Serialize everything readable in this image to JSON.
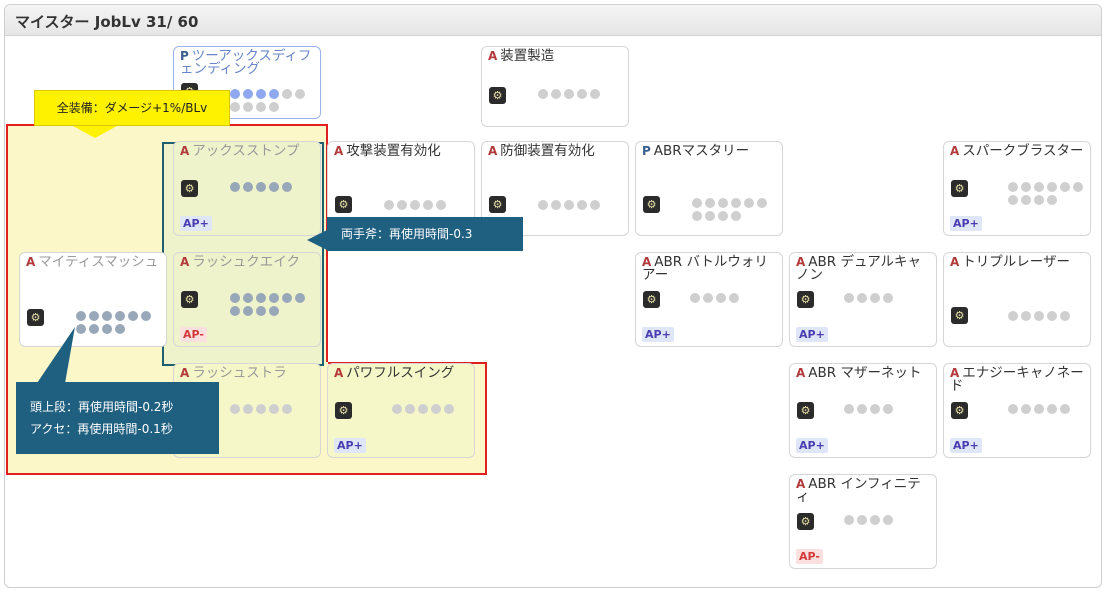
{
  "header": {
    "title": "マイスター JobLv 31/ 60"
  },
  "skills": [
    {
      "type": "P",
      "name": "ツーアックスディフェンディング",
      "dots": 5,
      "rows": 2,
      "filled": 4,
      "badge": ""
    },
    {
      "type": "A",
      "name": "装置製造",
      "dots": 5,
      "rows": 1,
      "filled": 0,
      "badge": ""
    },
    {
      "type": "A",
      "name": "アックスストンプ",
      "dots": 5,
      "rows": 1,
      "filled": 5,
      "badge": "AP+"
    },
    {
      "type": "A",
      "name": "攻撃装置有効化",
      "dots": 5,
      "rows": 1,
      "filled": 0,
      "badge": ""
    },
    {
      "type": "A",
      "name": "防御装置有効化",
      "dots": 5,
      "rows": 1,
      "filled": 0,
      "badge": ""
    },
    {
      "type": "P",
      "name": "ABRマスタリー",
      "dots": 5,
      "rows": 2,
      "filled": 0,
      "badge": ""
    },
    {
      "type": "A",
      "name": "スパークブラスター",
      "dots": 5,
      "rows": 2,
      "filled": 0,
      "badge": "AP+"
    },
    {
      "type": "A",
      "name": "マイティスマッシュ",
      "dots": 5,
      "rows": 2,
      "filled": 10,
      "badge": ""
    },
    {
      "type": "A",
      "name": "ラッシュクエイク",
      "dots": 5,
      "rows": 2,
      "filled": 10,
      "badge": "AP-"
    },
    {
      "type": "A",
      "name": "ABR バトルウォリアー",
      "dots": 4,
      "rows": 1,
      "filled": 0,
      "badge": "AP+"
    },
    {
      "type": "A",
      "name": "ABR デュアルキャノン",
      "dots": 4,
      "rows": 1,
      "filled": 0,
      "badge": "AP+"
    },
    {
      "type": "A",
      "name": "トリプルレーザー",
      "dots": 5,
      "rows": 1,
      "filled": 0,
      "badge": ""
    },
    {
      "type": "A",
      "name": "ラッシュストラ",
      "dots": 5,
      "rows": 1,
      "filled": 0,
      "badge": ""
    },
    {
      "type": "A",
      "name": "パワフルスイング",
      "dots": 5,
      "rows": 1,
      "filled": 0,
      "badge": "AP+"
    },
    {
      "type": "A",
      "name": "ABR マザーネット",
      "dots": 4,
      "rows": 1,
      "filled": 0,
      "badge": "AP+"
    },
    {
      "type": "A",
      "name": "エナジーキャノネード",
      "dots": 5,
      "rows": 1,
      "filled": 0,
      "badge": "AP+"
    },
    {
      "type": "A",
      "name": "ABR インフィニティ",
      "dots": 4,
      "rows": 1,
      "filled": 0,
      "badge": "AP-"
    }
  ],
  "tooltips": {
    "all_equip": "全装備：ダメージ+1%/BLv",
    "two_hand_axe": "両手斧：再使用時間-0.3",
    "head_top": "頭上段：再使用時間-0.2秒",
    "accessory": "アクセ：再使用時間-0.1秒"
  }
}
